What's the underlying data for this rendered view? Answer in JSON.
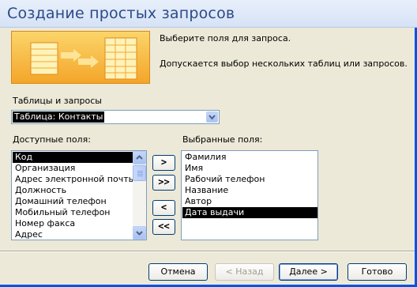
{
  "window": {
    "title": "Создание простых запросов"
  },
  "intro": {
    "line1": "Выберите поля для запроса.",
    "line2": "Допускается выбор нескольких таблиц или запросов."
  },
  "source": {
    "label": "Таблицы и запросы",
    "value": "Таблица: Контакты"
  },
  "available": {
    "label": "Доступные поля:",
    "items": [
      "Код",
      "Организация",
      "Адрес электронной почты",
      "Должность",
      "Домашний телефон",
      "Мобильный телефон",
      "Номер факса",
      "Адрес"
    ],
    "selected_index": 0
  },
  "chosen": {
    "label": "Выбранные поля:",
    "items": [
      "Фамилия",
      "Имя",
      "Рабочий телефон",
      "Название",
      "Автор",
      "Дата выдачи"
    ],
    "selected_index": 5
  },
  "move_buttons": {
    "add_one": ">",
    "add_all": ">>",
    "remove_one": "<",
    "remove_all": "<<"
  },
  "footer": {
    "cancel": "Отмена",
    "back": "< Назад",
    "next": "Далее >",
    "finish": "Готово"
  },
  "colors": {
    "title_text": "#2c4a86",
    "window_frame": "#0054e3",
    "dialog_background": "#ece9d8"
  },
  "icons": {
    "illustration": "tables-to-query-illustration",
    "combo": "chevron-down-icon",
    "scroll_up": "chevron-up-icon",
    "scroll_down": "chevron-down-icon"
  }
}
